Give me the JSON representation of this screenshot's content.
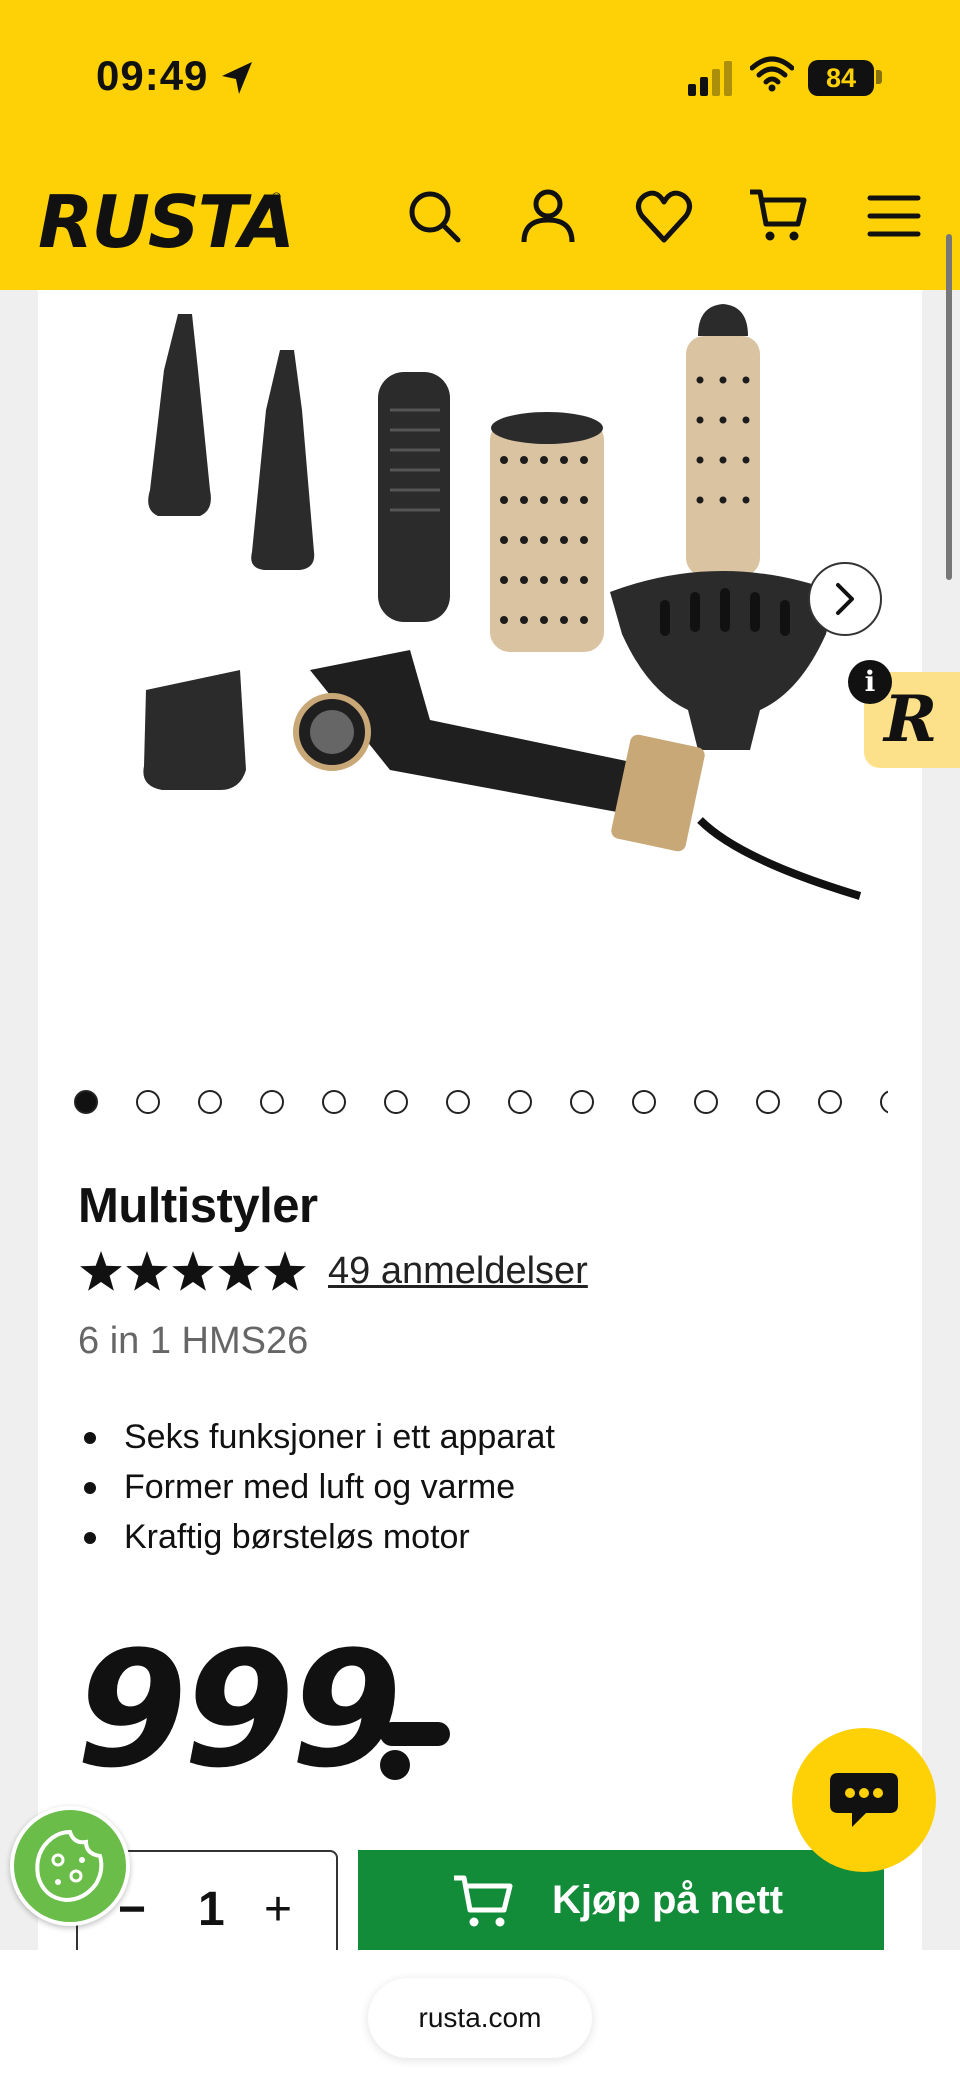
{
  "status_bar": {
    "time": "09:49",
    "battery": "84"
  },
  "header": {
    "logo": "RUSTA",
    "logo_mark": "®"
  },
  "product": {
    "title": "Multistyler",
    "rating_stars": 5,
    "reviews_link": "49 anmeldelser",
    "subtitle": "6 in 1 HMS26",
    "bullets": [
      "Seks funksjoner i ett apparat",
      "Former med luft og varme",
      "Kraftig børsteløs motor"
    ],
    "price": "999"
  },
  "carousel": {
    "total_dots": 14,
    "active_index": 0
  },
  "purchase": {
    "quantity": "1",
    "minus": "−",
    "plus": "+",
    "buy_label": "Kjøp på nett"
  },
  "badge": {
    "info": "i",
    "review_logo": "R"
  },
  "browser": {
    "url": "rusta.com"
  },
  "colors": {
    "brand_yellow": "#fdd106",
    "buy_green": "#138c3a",
    "cookie_green": "#6bbd4a"
  }
}
